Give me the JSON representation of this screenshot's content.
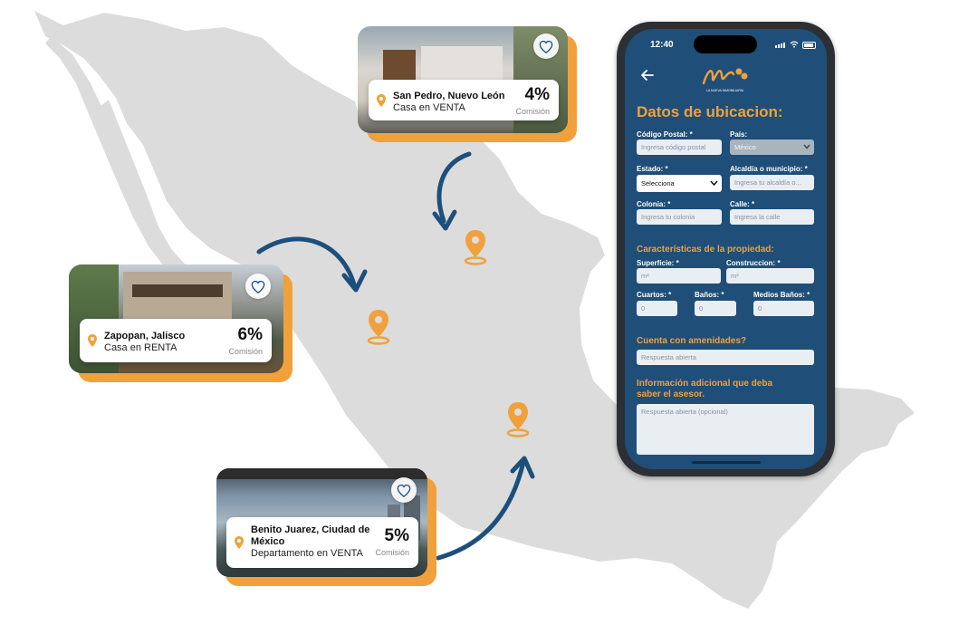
{
  "colors": {
    "accent": "#f0a13c",
    "map": "#dcdcdc",
    "arrow": "#1d4f7c",
    "screen": "#1f4e78"
  },
  "cards": [
    {
      "location": "San Pedro, Nuevo León",
      "type": "Casa en VENTA",
      "commission_pct": "4%",
      "commission_label": "Comisión",
      "icons": [
        "heart-icon",
        "map-pin-icon"
      ]
    },
    {
      "location": "Zapopan, Jalisco",
      "type": "Casa en RENTA",
      "commission_pct": "6%",
      "commission_label": "Comisión",
      "icons": [
        "heart-icon",
        "map-pin-icon"
      ]
    },
    {
      "location_line1": "Benito Juarez, Ciudad de",
      "location_line2": "México",
      "type": "Departamento en VENTA",
      "commission_pct": "5%",
      "commission_label": "Comisión",
      "icons": [
        "heart-icon",
        "map-pin-icon"
      ]
    }
  ],
  "phone": {
    "status_time": "12:40",
    "logo_tagline": "LA NUEVA INMOBILIARIA",
    "title": "Datos de ubicacion:",
    "fields": {
      "postal_code": {
        "label": "Código Postal: *",
        "placeholder": "Ingresa código postal"
      },
      "country": {
        "label": "País:",
        "value": "México"
      },
      "state": {
        "label": "Estado: *",
        "value": "Selecciona"
      },
      "municipality": {
        "label": "Alcaldía o municipio: *",
        "placeholder": "Ingresa tu alcaldía o..."
      },
      "colonia": {
        "label": "Colonia: *",
        "placeholder": "Ingresa tu colonia"
      },
      "street": {
        "label": "Calle: *",
        "placeholder": "Ingresa la calle"
      }
    },
    "characteristics_title": "Características de la propiedad:",
    "characteristics": {
      "surface": {
        "label": "Superficie: *",
        "placeholder": "m²"
      },
      "construction": {
        "label": "Construccion: *",
        "placeholder": "m²"
      },
      "rooms": {
        "label": "Cuartos: *",
        "placeholder": "0"
      },
      "bathrooms": {
        "label": "Baños: *",
        "placeholder": "0"
      },
      "half_baths": {
        "label": "Medios Baños: *",
        "placeholder": "0"
      }
    },
    "amenities_title": "Cuenta con amenidades?",
    "amenities_placeholder": "Respuesta abierta",
    "additional_title_line1": "Información adicional que deba",
    "additional_title_line2": "saber el asesor.",
    "additional_placeholder": "Respuesta abierta (opcional)"
  }
}
